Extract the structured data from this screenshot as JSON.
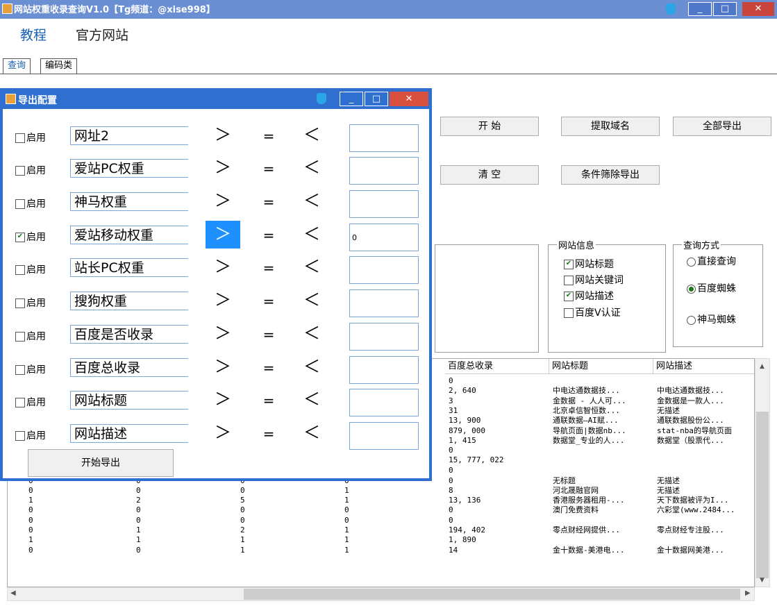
{
  "window": {
    "title": "网站权重收录查询V1.0【Tg频道：@xise998】",
    "min": "_",
    "max": "□",
    "close": "✕"
  },
  "menu": {
    "tutorial": "教程",
    "official": "官方网站"
  },
  "tabs": [
    {
      "label": "查询"
    },
    {
      "label": "编码类"
    }
  ],
  "buttons": {
    "start": "开 始",
    "extract": "提取域名",
    "export_all": "全部导出",
    "clear": "清 空",
    "filter_export": "条件筛除导出"
  },
  "site_info": {
    "legend": "网站信息",
    "items": [
      {
        "label": "网站标题",
        "checked": true
      },
      {
        "label": "网站关键词",
        "checked": false
      },
      {
        "label": "网站描述",
        "checked": true
      },
      {
        "label": "百度V认证",
        "checked": false
      }
    ]
  },
  "query_mode": {
    "legend": "查询方式",
    "options": [
      {
        "label": "直接查询",
        "selected": false
      },
      {
        "label": "百度蜘蛛",
        "selected": true
      },
      {
        "label": "神马蜘蛛",
        "selected": false
      }
    ]
  },
  "grid": {
    "headers": [
      "百度总收录",
      "网站标题",
      "网站描述"
    ],
    "top_rows": [
      [
        "0",
        "",
        ""
      ],
      [
        "2, 640",
        "中电达通数据技...",
        "中电达通数据技..."
      ],
      [
        "3",
        "金数据 - 人人可...",
        "金数据是一款人..."
      ],
      [
        "31",
        "北京卓信智恒数...",
        "无描述"
      ],
      [
        "13, 900",
        "通联数据—AI赋...",
        "通联数据股份公..."
      ],
      [
        "879, 000",
        "导航页面|数据nb...",
        "stat-nba的导航页面"
      ],
      [
        "1, 415",
        "数据堂_专业的人...",
        "数据堂（股票代..."
      ],
      [
        "0",
        "",
        ""
      ],
      [
        "15, 777, 022",
        "",
        ""
      ]
    ],
    "full_rows": [
      [
        "0",
        "0",
        "0",
        "0",
        "0",
        "",
        ""
      ],
      [
        "0",
        "0",
        "0",
        "0",
        "0",
        "无标题",
        "无描述"
      ],
      [
        "0",
        "0",
        "0",
        "1",
        "8",
        "河北晟融官网",
        "无描述"
      ],
      [
        "1",
        "2",
        "5",
        "1",
        "13, 136",
        "香港服务器租用-...",
        "天下数据被评为I..."
      ],
      [
        "0",
        "0",
        "0",
        "0",
        "0",
        "澳门免费资料",
        "六彩堂(www.2484..."
      ],
      [
        "0",
        "0",
        "0",
        "0",
        "0",
        "",
        ""
      ],
      [
        "0",
        "1",
        "2",
        "1",
        "194, 402",
        "零点财经网提供...",
        "零点财经专注股..."
      ],
      [
        "1",
        "1",
        "1",
        "1",
        "1, 890",
        "",
        ""
      ],
      [
        "0",
        "0",
        "1",
        "1",
        "14",
        "金十数据-美港电...",
        "金十数据网美港..."
      ]
    ]
  },
  "dialog": {
    "title": "导出配置",
    "enable_label": "启用",
    "ops": {
      "gt": "＞",
      "eq": "=",
      "lt": "＜"
    },
    "rows": [
      {
        "field": "网址2",
        "checked": false,
        "value": "",
        "gt_selected": false
      },
      {
        "field": "爱站PC权重",
        "checked": false,
        "value": "",
        "gt_selected": false
      },
      {
        "field": "神马权重",
        "checked": false,
        "value": "",
        "gt_selected": false
      },
      {
        "field": "爱站移动权重",
        "checked": true,
        "value": "0",
        "gt_selected": true
      },
      {
        "field": "站长PC权重",
        "checked": false,
        "value": "",
        "gt_selected": false
      },
      {
        "field": "搜狗权重",
        "checked": false,
        "value": "",
        "gt_selected": false
      },
      {
        "field": "百度是否收录",
        "checked": false,
        "value": "",
        "gt_selected": false
      },
      {
        "field": "百度总收录",
        "checked": false,
        "value": "",
        "gt_selected": false
      },
      {
        "field": "网站标题",
        "checked": false,
        "value": "",
        "gt_selected": false
      },
      {
        "field": "网站描述",
        "checked": false,
        "value": "",
        "gt_selected": false
      }
    ],
    "export_button": "开始导出"
  }
}
